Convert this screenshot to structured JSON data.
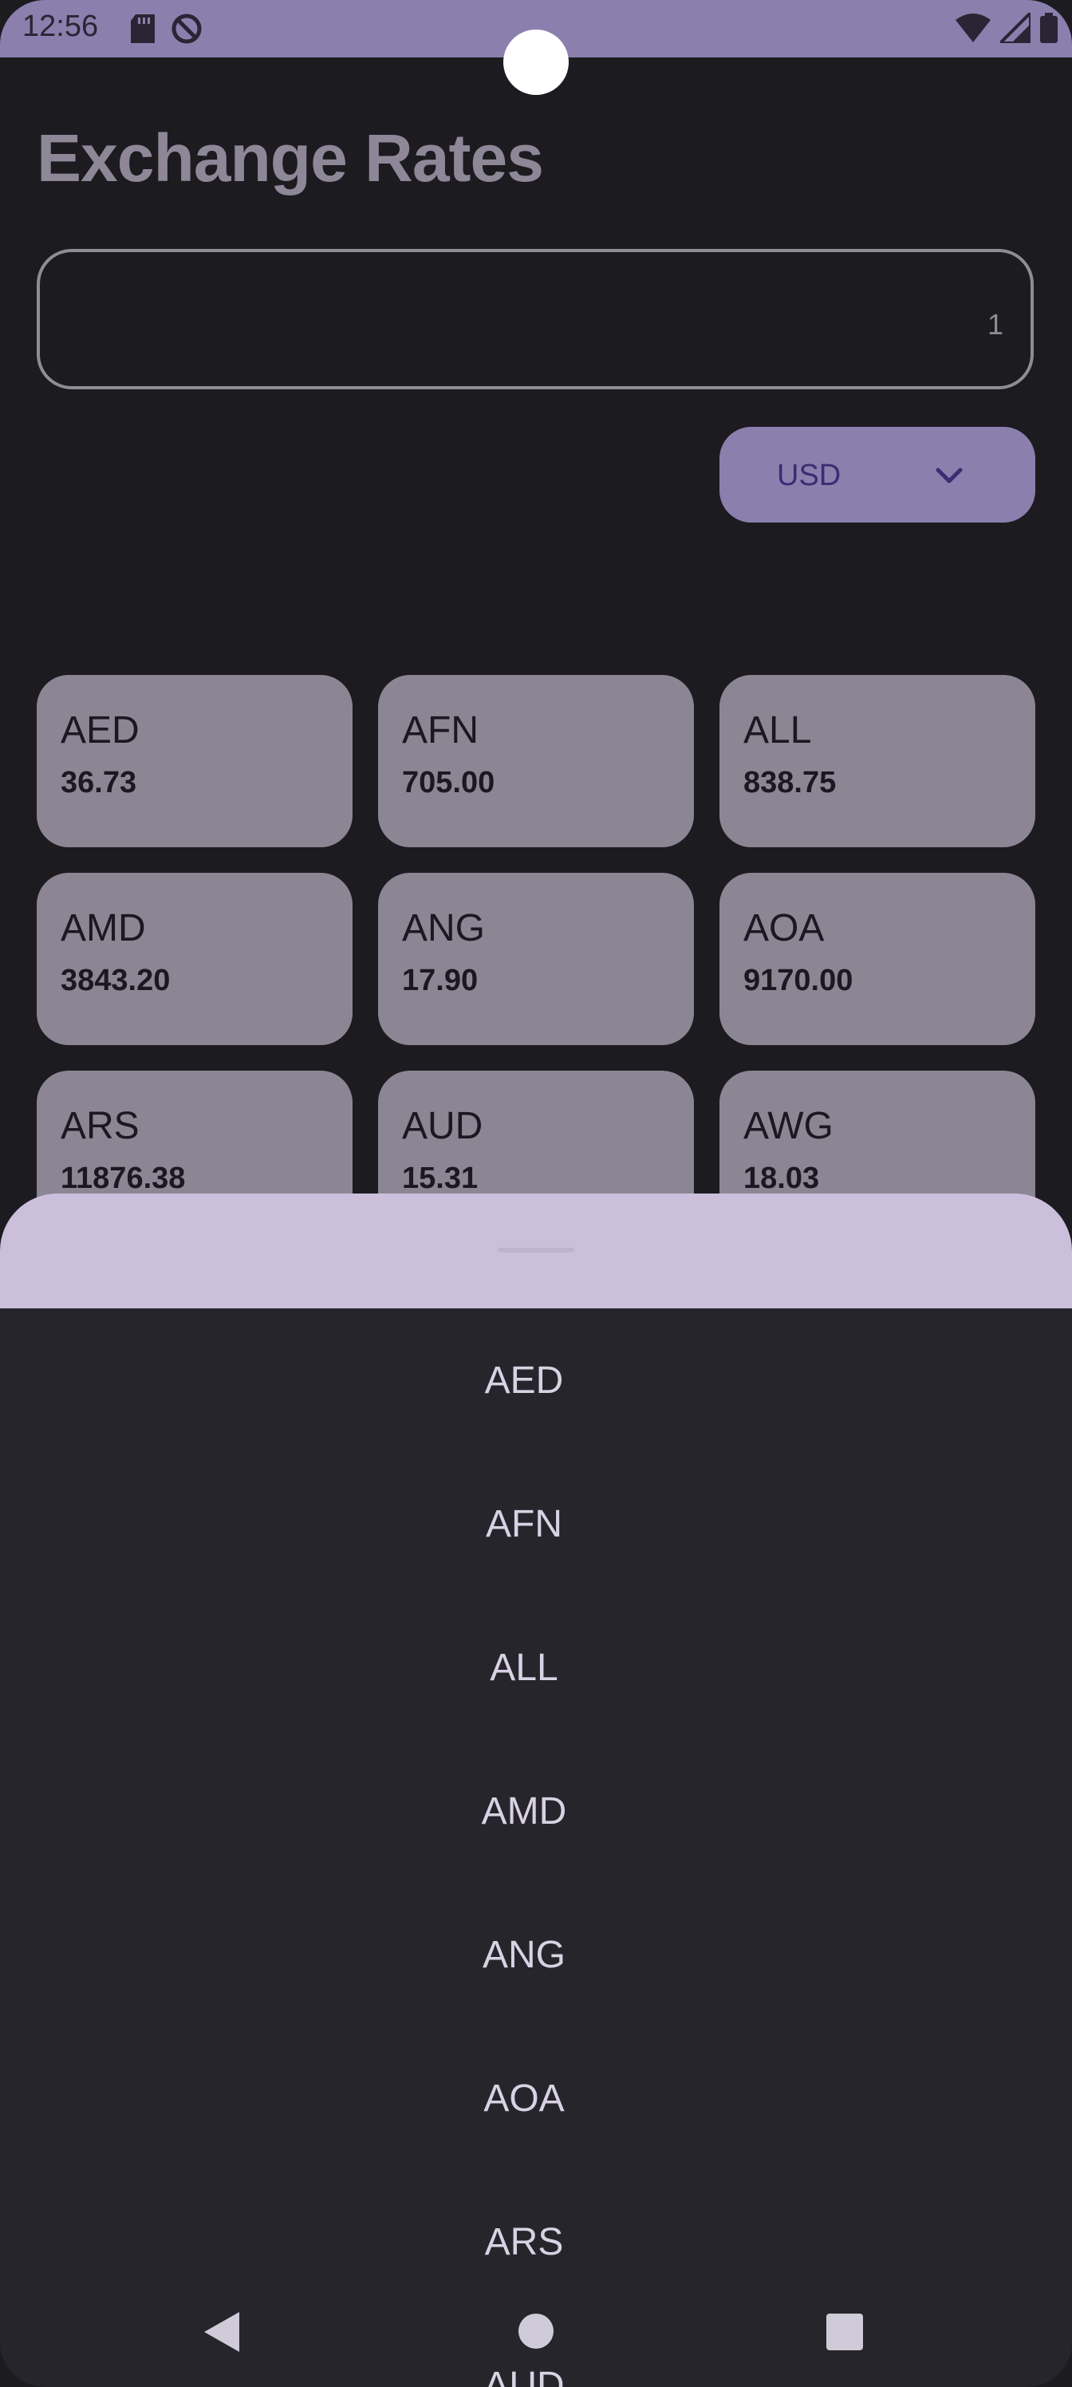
{
  "status_bar": {
    "time": "12:56",
    "icons_left": [
      "sd-card-icon",
      "do-not-disturb-icon"
    ],
    "icons_right": [
      "wifi-icon",
      "signal-icon",
      "battery-icon"
    ]
  },
  "header": {
    "title": "Exchange Rates"
  },
  "amount_input": {
    "value": "1"
  },
  "currency_select": {
    "selected": "USD",
    "icon": "chevron-down-icon"
  },
  "rates": [
    {
      "code": "AED",
      "value": "36.73"
    },
    {
      "code": "AFN",
      "value": "705.00"
    },
    {
      "code": "ALL",
      "value": "838.75"
    },
    {
      "code": "AMD",
      "value": "3843.20"
    },
    {
      "code": "ANG",
      "value": "17.90"
    },
    {
      "code": "AOA",
      "value": "9170.00"
    },
    {
      "code": "ARS",
      "value": "11876.38"
    },
    {
      "code": "AUD",
      "value": "15.31"
    },
    {
      "code": "AWG",
      "value": "18.03"
    }
  ],
  "currency_sheet": {
    "options": [
      "AED",
      "AFN",
      "ALL",
      "AMD",
      "ANG",
      "AOA",
      "ARS",
      "AUD"
    ]
  },
  "nav_bar": {
    "icons": [
      "back-icon",
      "home-icon",
      "recents-icon"
    ]
  },
  "colors": {
    "status_bar": "#8b7fae",
    "background": "#1c1b20",
    "card": "#8c8694",
    "sheet_header": "#cbbfdc",
    "sheet_list": "#26252b",
    "accent_text": "#3b2d72"
  }
}
